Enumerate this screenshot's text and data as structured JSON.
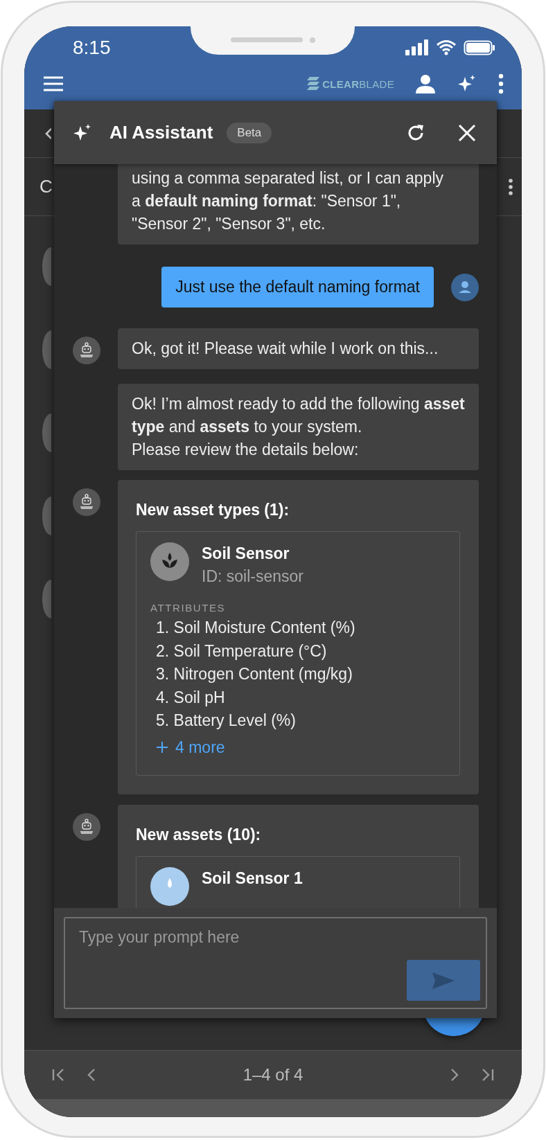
{
  "status_bar": {
    "time": "8:15"
  },
  "app_bar": {
    "logo": "**CLEAR**BLADE"
  },
  "page": {
    "title": "C"
  },
  "assistant": {
    "title": "AI Assistant",
    "badge": "Beta",
    "messages": [
      {
        "kind": "bot_text",
        "avatar": false,
        "text": "using a comma separated list, or I can apply a **default naming format**: \"Sensor 1\", \"Sensor 2\", \"Sensor 3\", etc."
      },
      {
        "kind": "user_text",
        "avatar": true,
        "text": "Just use the default naming format"
      },
      {
        "kind": "bot_text",
        "avatar": true,
        "text": "Ok, got it! Please wait while I work on this..."
      },
      {
        "kind": "bot_text",
        "avatar": false,
        "text": "Ok! I’m almost ready to add the following **asset type** and **assets** to your system.\nPlease review the details below:"
      },
      {
        "kind": "asset_types",
        "avatar": true,
        "heading": "New asset types (1):",
        "items": [
          {
            "name": "Soil Sensor",
            "id": "ID: soil-sensor",
            "attributes_label": "ATTRIBUTES",
            "attributes": [
              "1. Soil Moisture Content (%)",
              "2. Soil Temperature (°C)",
              "3. Nitrogen Content (mg/kg)",
              "4. Soil pH",
              "5. Battery Level (%)"
            ],
            "more": "4 more"
          }
        ]
      },
      {
        "kind": "assets",
        "avatar": true,
        "heading": "New assets (10):",
        "items": [
          {
            "name": "Soil Sensor 1"
          }
        ]
      }
    ],
    "input": {
      "placeholder": "Type your prompt here",
      "send_disabled": true
    }
  },
  "pagination": {
    "range": "1–4 of 4"
  }
}
